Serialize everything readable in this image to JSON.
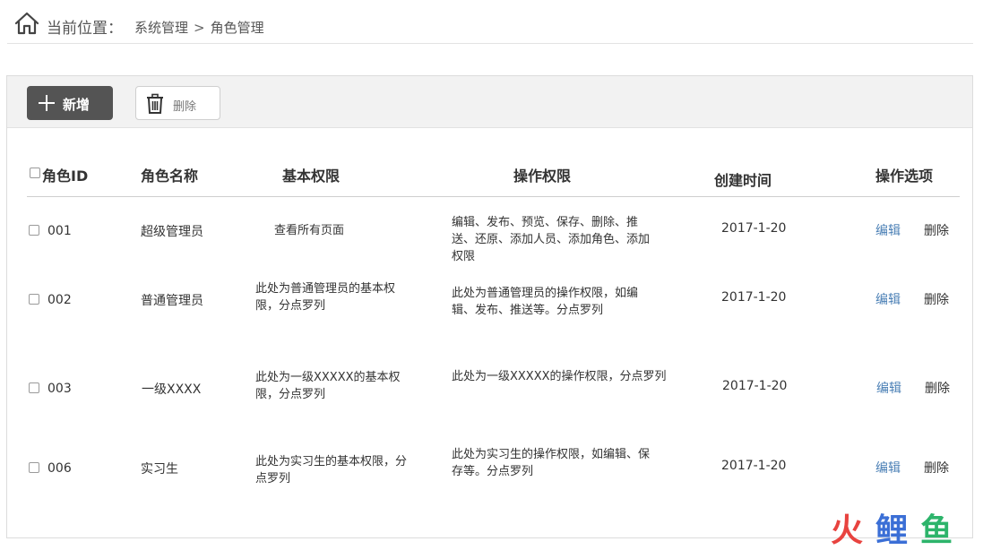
{
  "breadcrumb": {
    "label": "当前位置：",
    "parent": "系统管理",
    "separator": ">",
    "current": "角色管理"
  },
  "toolbar": {
    "add_label": "新增",
    "delete_label": "删除"
  },
  "table": {
    "headers": {
      "id": "角色ID",
      "name": "角色名称",
      "basic": "基本权限",
      "ops": "操作权限",
      "created": "创建时间",
      "actions": "操作选项"
    },
    "rows": [
      {
        "id": "001",
        "name": "超级管理员",
        "basic": "查看所有页面",
        "ops": "编辑、发布、预览、保存、删除、推送、还原、添加人员、添加角色、添加权限",
        "created": "2017-1-20",
        "edit": "编辑",
        "delete": "删除"
      },
      {
        "id": "002",
        "name": "普通管理员",
        "basic": "此处为普通管理员的基本权限，分点罗列",
        "ops": "此处为普通管理员的操作权限，如编辑、发布、推送等。分点罗列",
        "created": "2017-1-20",
        "edit": "编辑",
        "delete": "删除"
      },
      {
        "id": "003",
        "name": "一级XXXX",
        "basic": "此处为一级XXXXX的基本权限，分点罗列",
        "ops": "此处为一级XXXXX的操作权限，分点罗列",
        "created": "2017-1-20",
        "edit": "编辑",
        "delete": "删除"
      },
      {
        "id": "006",
        "name": "实习生",
        "basic": "此处为实习生的基本权限，分点罗列",
        "ops": "此处为实习生的操作权限，如编辑、保存等。分点罗列",
        "created": "2017-1-20",
        "edit": "编辑",
        "delete": "删除"
      }
    ]
  },
  "watermark": {
    "text": "火鲤鱼",
    "colors": [
      "#e8433f",
      "#3b6fd6",
      "#f2a024",
      "#2db46b"
    ]
  }
}
